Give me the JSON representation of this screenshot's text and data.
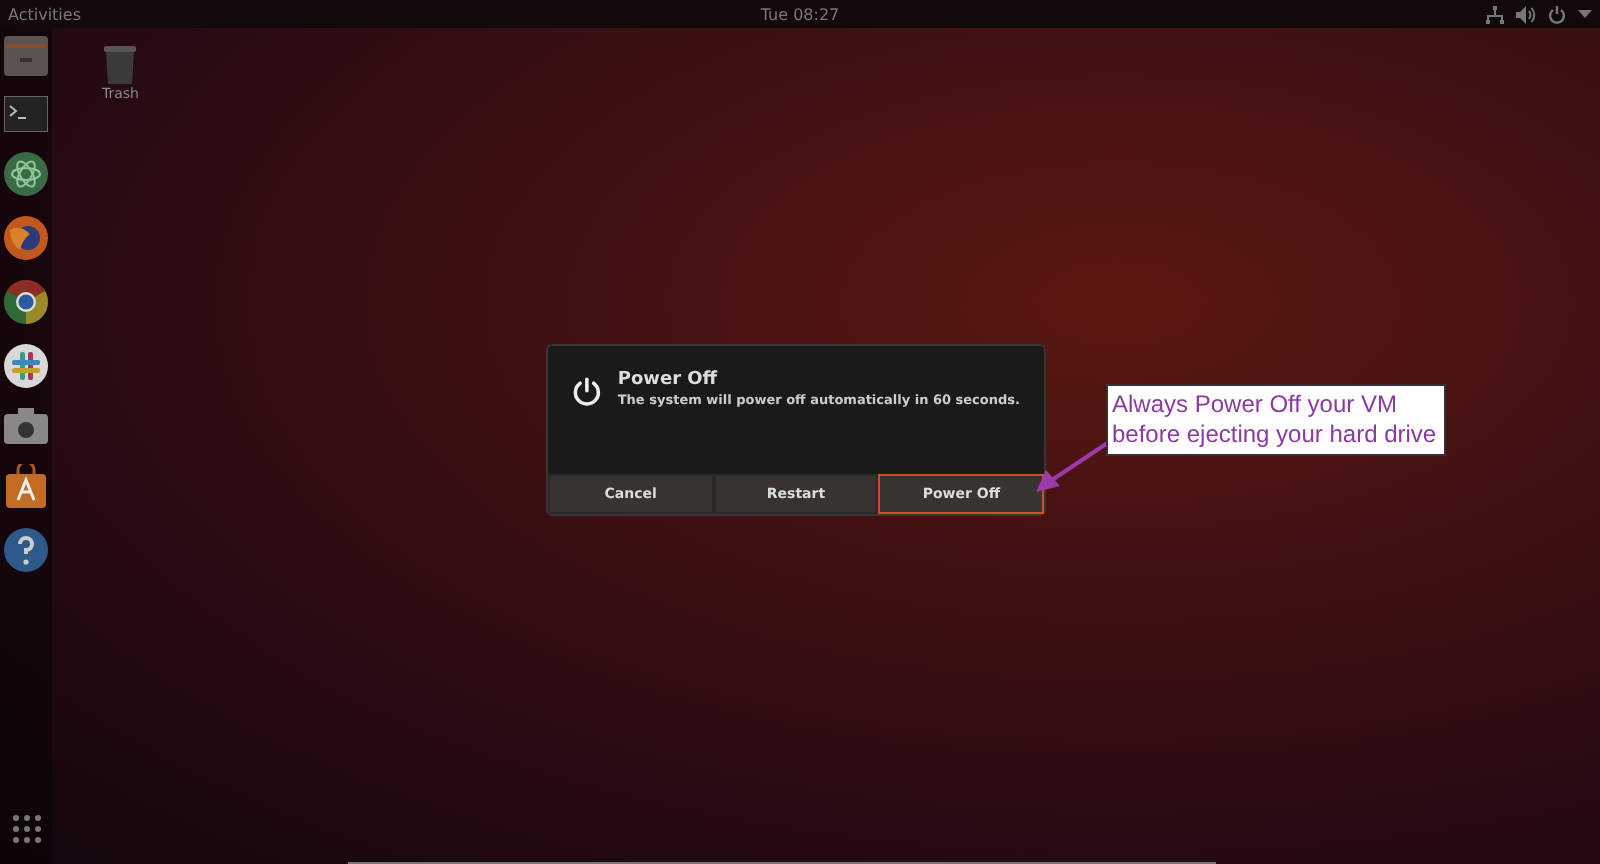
{
  "top_bar": {
    "activities": "Activities",
    "clock": "Tue 08:27"
  },
  "desktop": {
    "icons": [
      {
        "label": "Trash"
      }
    ]
  },
  "dialog": {
    "title": "Power Off",
    "message": "The system will power off automatically in 60 seconds.",
    "buttons": [
      {
        "label": "Cancel",
        "selected": false
      },
      {
        "label": "Restart",
        "selected": false
      },
      {
        "label": "Power Off",
        "selected": true
      }
    ]
  },
  "annotation": {
    "text": "Always Power Off your VM before ejecting your hard drive"
  }
}
